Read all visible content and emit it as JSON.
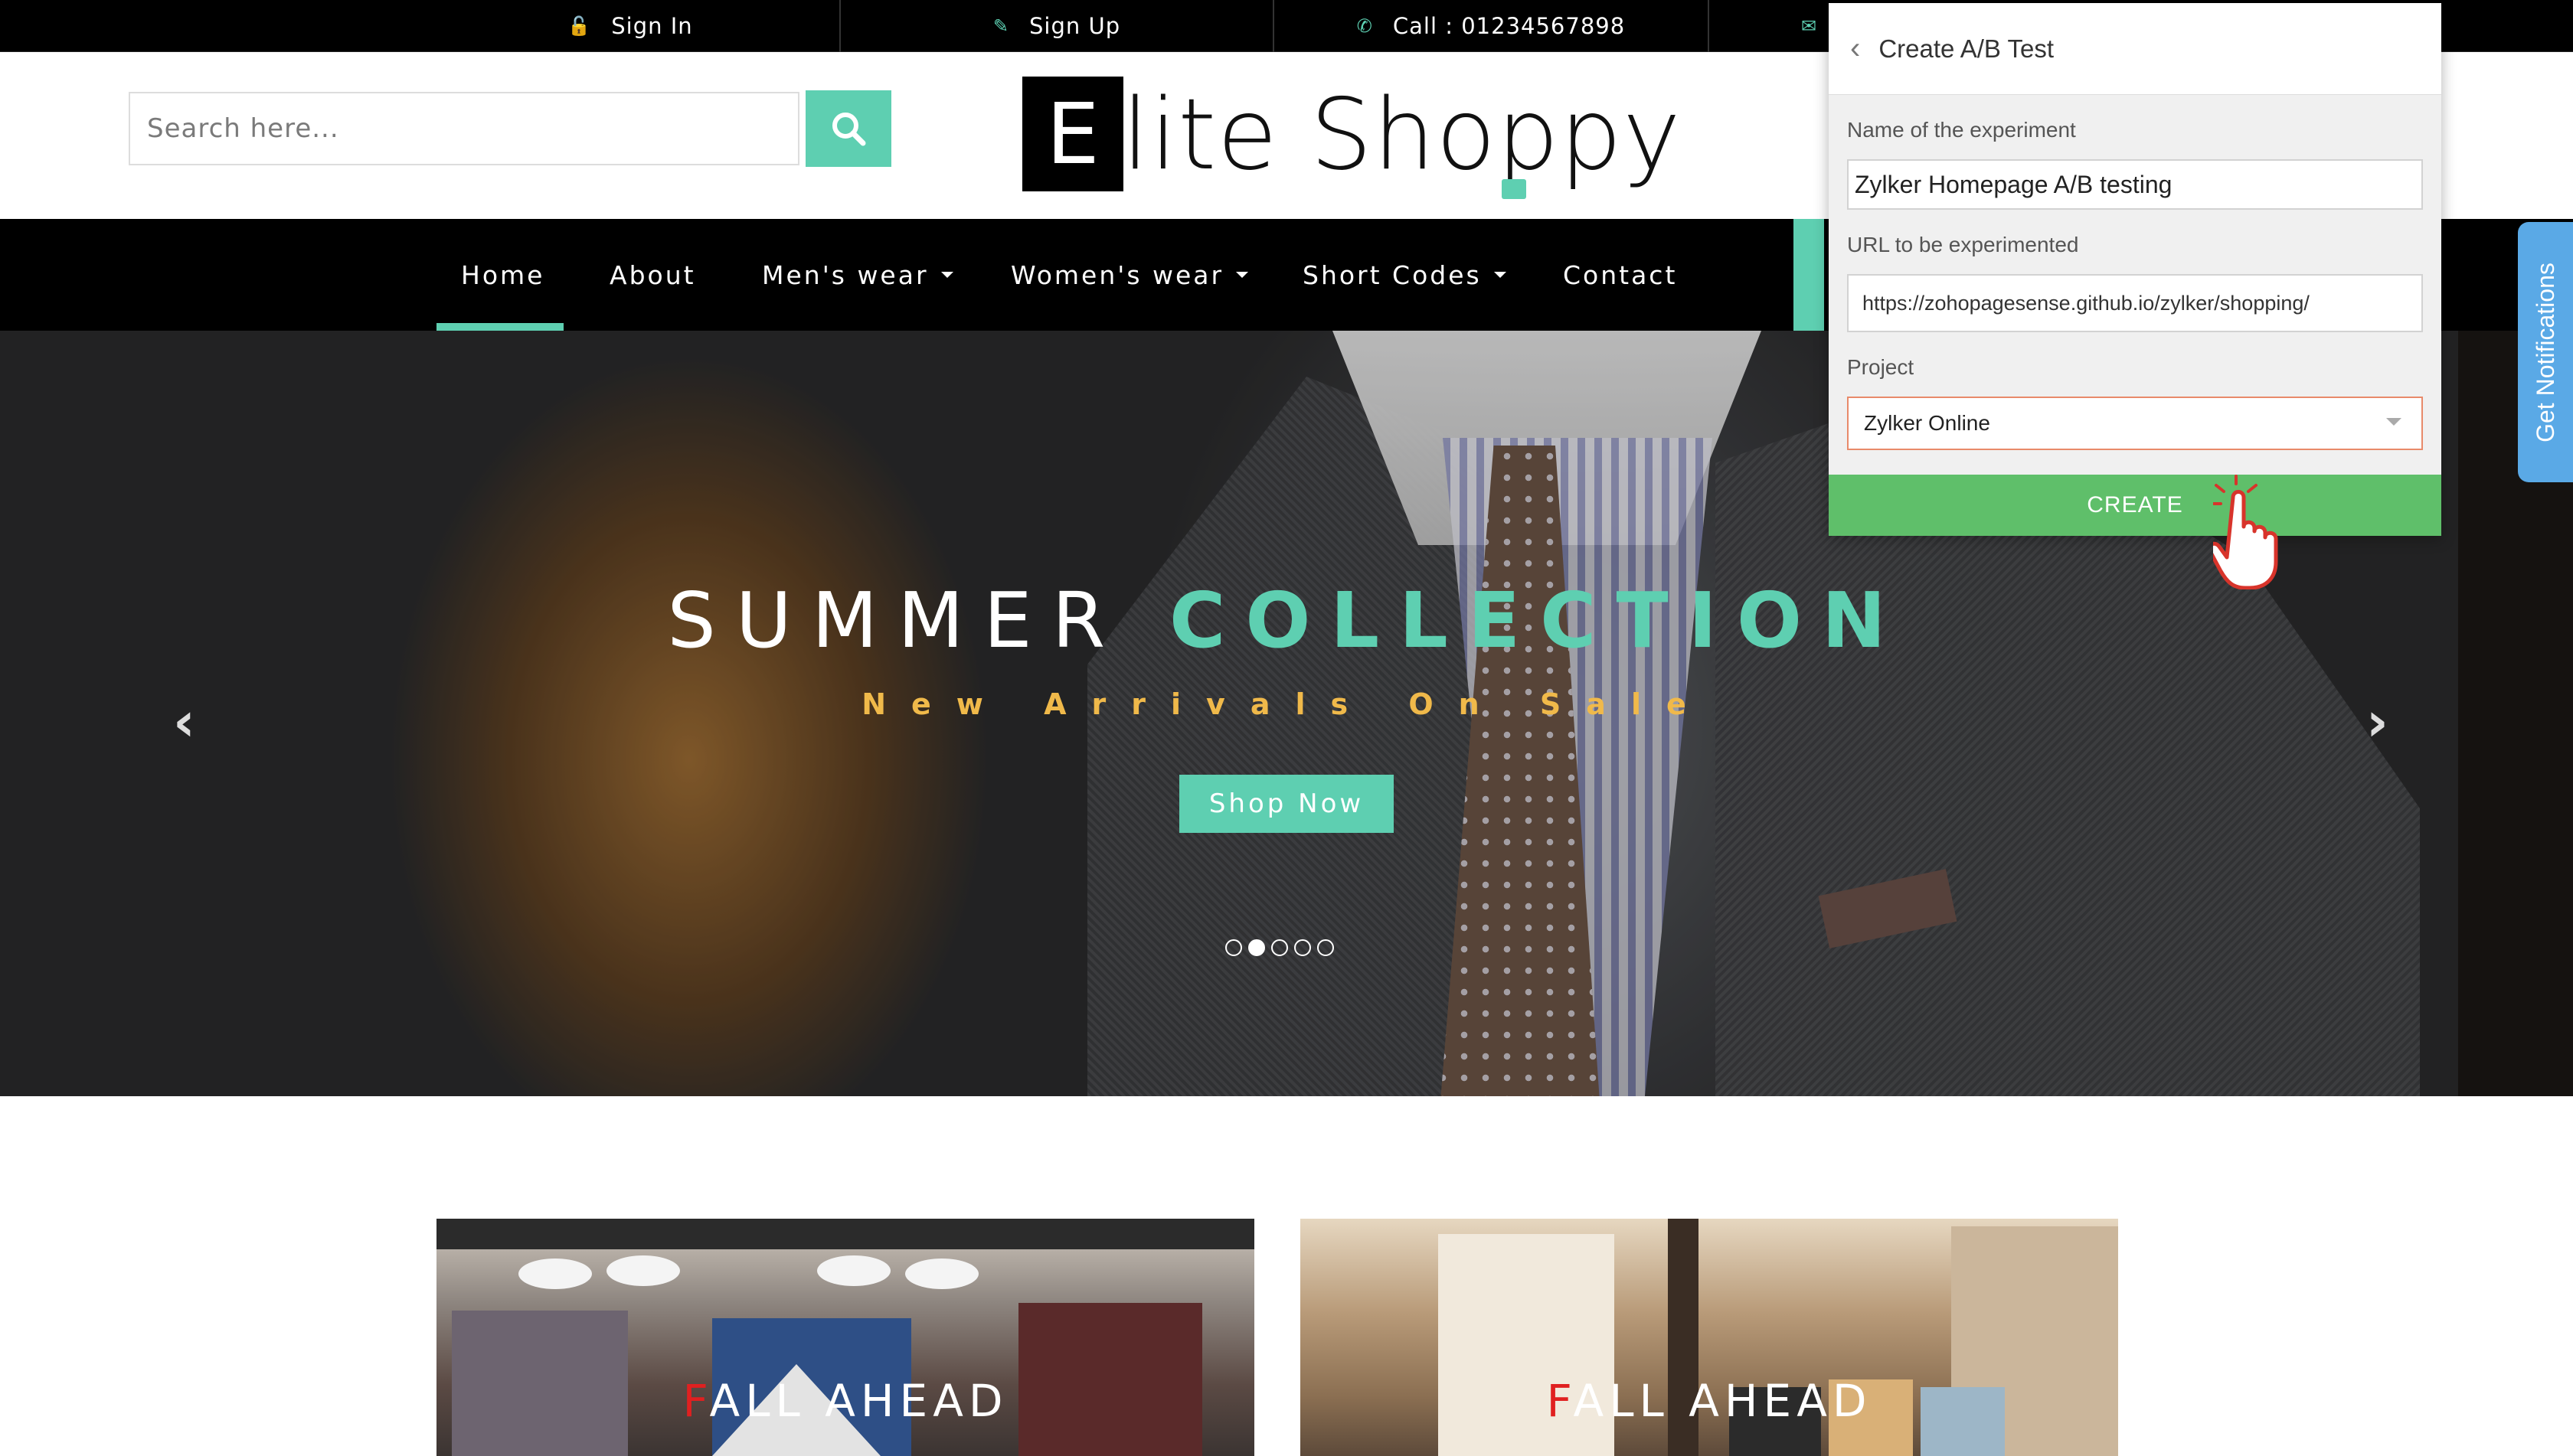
{
  "topbar": {
    "sign_in": "Sign In",
    "sign_up": "Sign Up",
    "call": "Call : 01234567898"
  },
  "header": {
    "search_placeholder": "Search here...",
    "logo_letter": "E",
    "logo_rest": "lite Shoppy"
  },
  "nav": {
    "items": [
      {
        "label": "Home"
      },
      {
        "label": "About"
      },
      {
        "label": "Men's wear"
      },
      {
        "label": "Women's wear"
      },
      {
        "label": "Short Codes"
      },
      {
        "label": "Contact"
      }
    ]
  },
  "hero": {
    "title_light": "SUMMER",
    "title_bold": "COLLECTION",
    "subtitle": "New Arrivals On Sale",
    "cta": "Shop Now",
    "active_slide": 2,
    "slide_count": 5
  },
  "cards": [
    {
      "first": "F",
      "rest": "ALL AHEAD"
    },
    {
      "first": "F",
      "rest": "ALL AHEAD"
    }
  ],
  "ab_panel": {
    "title": "Create A/B Test",
    "name_label": "Name of the experiment",
    "name_value": "Zylker Homepage A/B testing",
    "url_label": "URL to be experimented",
    "url_value": "https://zohopagesense.github.io/zylker/shopping/",
    "project_label": "Project",
    "project_value": "Zylker Online",
    "create_label": "CREATE"
  },
  "notifications_tab": "Get Notifications",
  "colors": {
    "accent": "#5ecfb1",
    "create_green": "#5fbf6a",
    "subtitle_gold": "#f0b94a",
    "notif_blue": "#5aa9e6"
  }
}
